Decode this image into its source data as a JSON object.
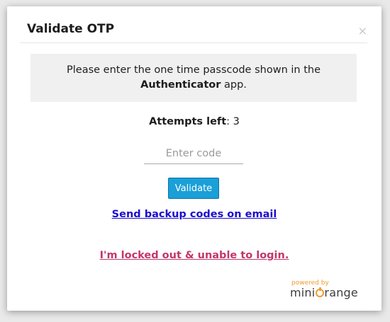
{
  "modal": {
    "title": "Validate OTP",
    "close_glyph": "×"
  },
  "notice": {
    "text_before": "Please enter the one time passcode shown in the",
    "app_name": "Authenticator",
    "text_after": " app."
  },
  "attempts": {
    "label": "Attempts left",
    "separator": ": ",
    "count": "3"
  },
  "code_input": {
    "placeholder": "Enter code",
    "value": ""
  },
  "validate_button": {
    "label": "Validate"
  },
  "links": {
    "backup": "Send backup codes on email",
    "locked_out": "I'm locked out & unable to login."
  },
  "branding": {
    "powered_by": "powered by",
    "name_prefix": "mini",
    "name_suffix": "range",
    "logo_icon": "orange-power-icon"
  },
  "colors": {
    "accent_button": "#1a9fd8",
    "backup_link": "#1a0dcc",
    "locked_link": "#c2366a",
    "brand_orange": "#f29a2e"
  }
}
